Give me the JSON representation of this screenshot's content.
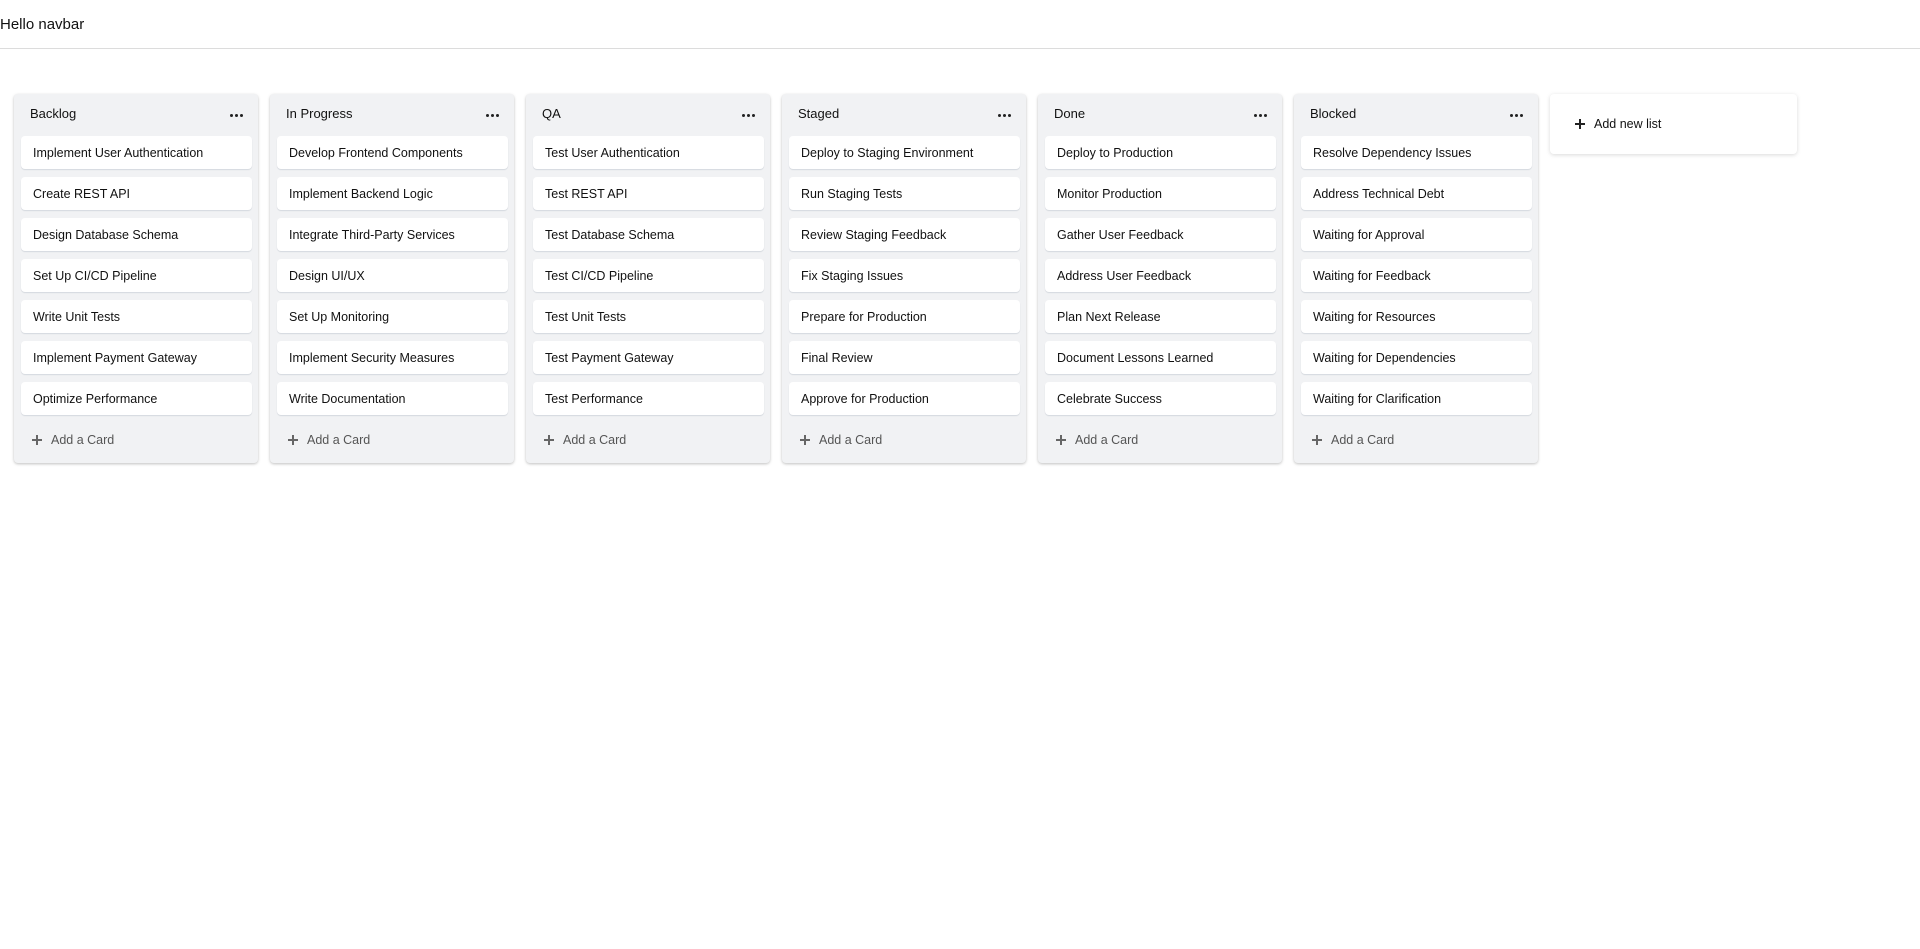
{
  "navbar": {
    "title": "Hello navbar"
  },
  "board": {
    "add_card_label": "Add a Card",
    "add_list_label": "Add new list",
    "lists": [
      {
        "title": "Backlog",
        "cards": [
          "Implement User Authentication",
          "Create REST API",
          "Design Database Schema",
          "Set Up CI/CD Pipeline",
          "Write Unit Tests",
          "Implement Payment Gateway",
          "Optimize Performance"
        ]
      },
      {
        "title": "In Progress",
        "cards": [
          "Develop Frontend Components",
          "Implement Backend Logic",
          "Integrate Third-Party Services",
          "Design UI/UX",
          "Set Up Monitoring",
          "Implement Security Measures",
          "Write Documentation"
        ]
      },
      {
        "title": "QA",
        "cards": [
          "Test User Authentication",
          "Test REST API",
          "Test Database Schema",
          "Test CI/CD Pipeline",
          "Test Unit Tests",
          "Test Payment Gateway",
          "Test Performance"
        ]
      },
      {
        "title": "Staged",
        "cards": [
          "Deploy to Staging Environment",
          "Run Staging Tests",
          "Review Staging Feedback",
          "Fix Staging Issues",
          "Prepare for Production",
          "Final Review",
          "Approve for Production"
        ]
      },
      {
        "title": "Done",
        "cards": [
          "Deploy to Production",
          "Monitor Production",
          "Gather User Feedback",
          "Address User Feedback",
          "Plan Next Release",
          "Document Lessons Learned",
          "Celebrate Success"
        ]
      },
      {
        "title": "Blocked",
        "cards": [
          "Resolve Dependency Issues",
          "Address Technical Debt",
          "Waiting for Approval",
          "Waiting for Feedback",
          "Waiting for Resources",
          "Waiting for Dependencies",
          "Waiting for Clarification"
        ]
      }
    ]
  }
}
